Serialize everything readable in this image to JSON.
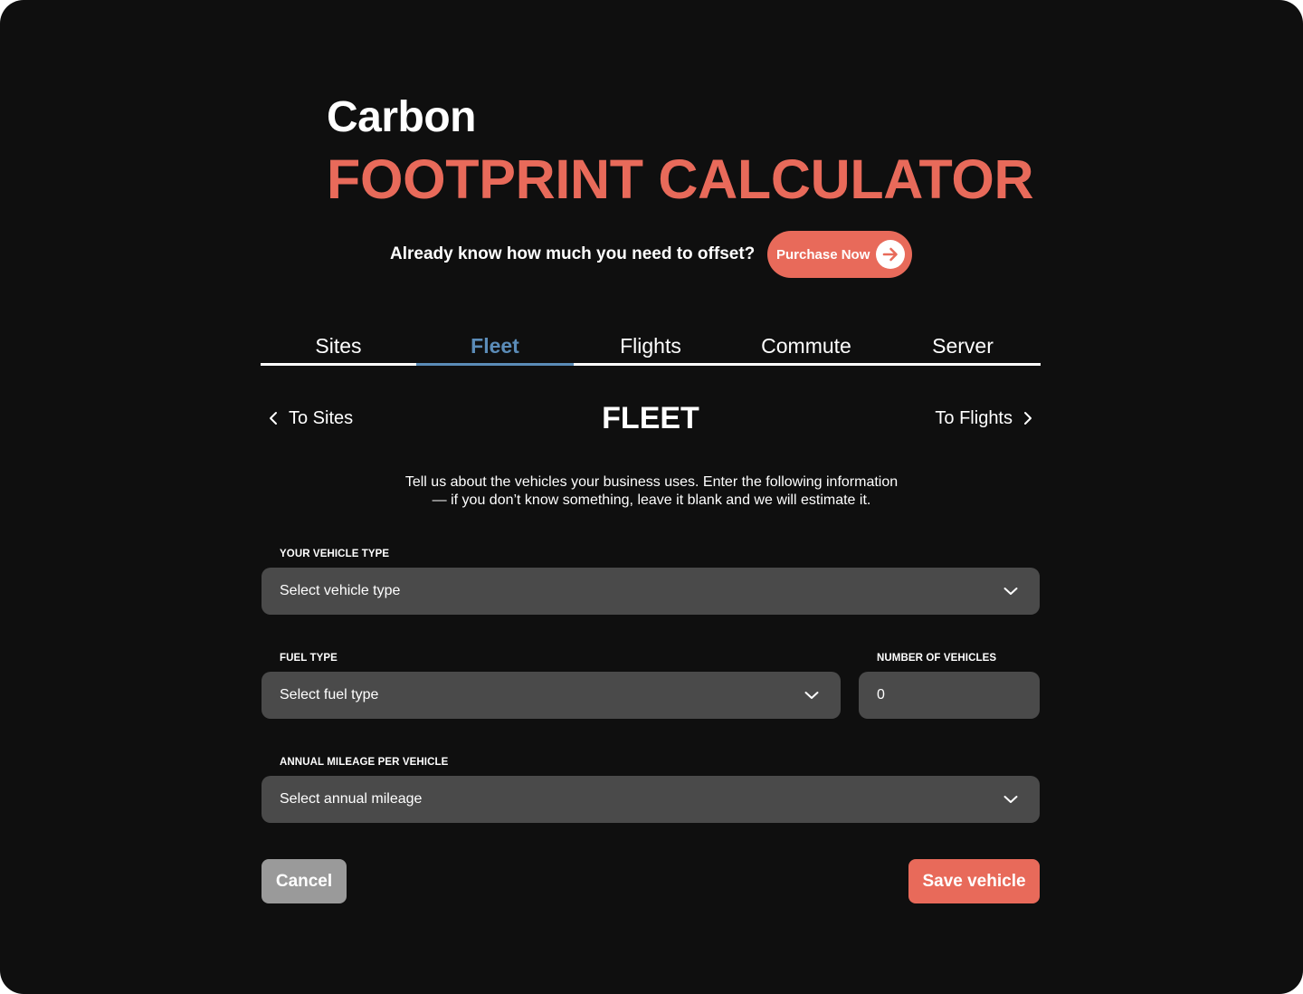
{
  "header": {
    "title_line1": "Carbon",
    "title_line2": "FOOTPRINT CALCULATOR",
    "offset_question": "Already know how much you need to offset?",
    "purchase_label": "Purchase Now",
    "purchase_icon": "arrow-right-icon"
  },
  "tabs": [
    {
      "label": "Sites",
      "active": false
    },
    {
      "label": "Fleet",
      "active": true
    },
    {
      "label": "Flights",
      "active": false
    },
    {
      "label": "Commute",
      "active": false
    },
    {
      "label": "Server",
      "active": false
    }
  ],
  "section": {
    "prev_label": "To Sites",
    "title": "FLEET",
    "next_label": "To Flights",
    "description_line1": "Tell us about the vehicles your business uses. Enter the following information",
    "description_line2": "— if you don’t know something, leave it blank and we will estimate it."
  },
  "form": {
    "vehicle_type": {
      "label": "YOUR VEHICLE TYPE",
      "value": "Select vehicle type"
    },
    "fuel_type": {
      "label": "FUEL TYPE",
      "value": "Select fuel type"
    },
    "num_vehicles": {
      "label": "NUMBER OF VEHICLES",
      "value": "0"
    },
    "annual_mileage": {
      "label": "ANNUAL MILEAGE PER VEHICLE",
      "value": "Select annual mileage"
    }
  },
  "actions": {
    "cancel_label": "Cancel",
    "save_label": "Save vehicle"
  },
  "colors": {
    "background": "#0f0f0f",
    "accent": "#e86a5a",
    "active_tab": "#5b8cb8",
    "field_bg": "#4a4a4a",
    "cancel_bg": "#9a9a9a"
  }
}
